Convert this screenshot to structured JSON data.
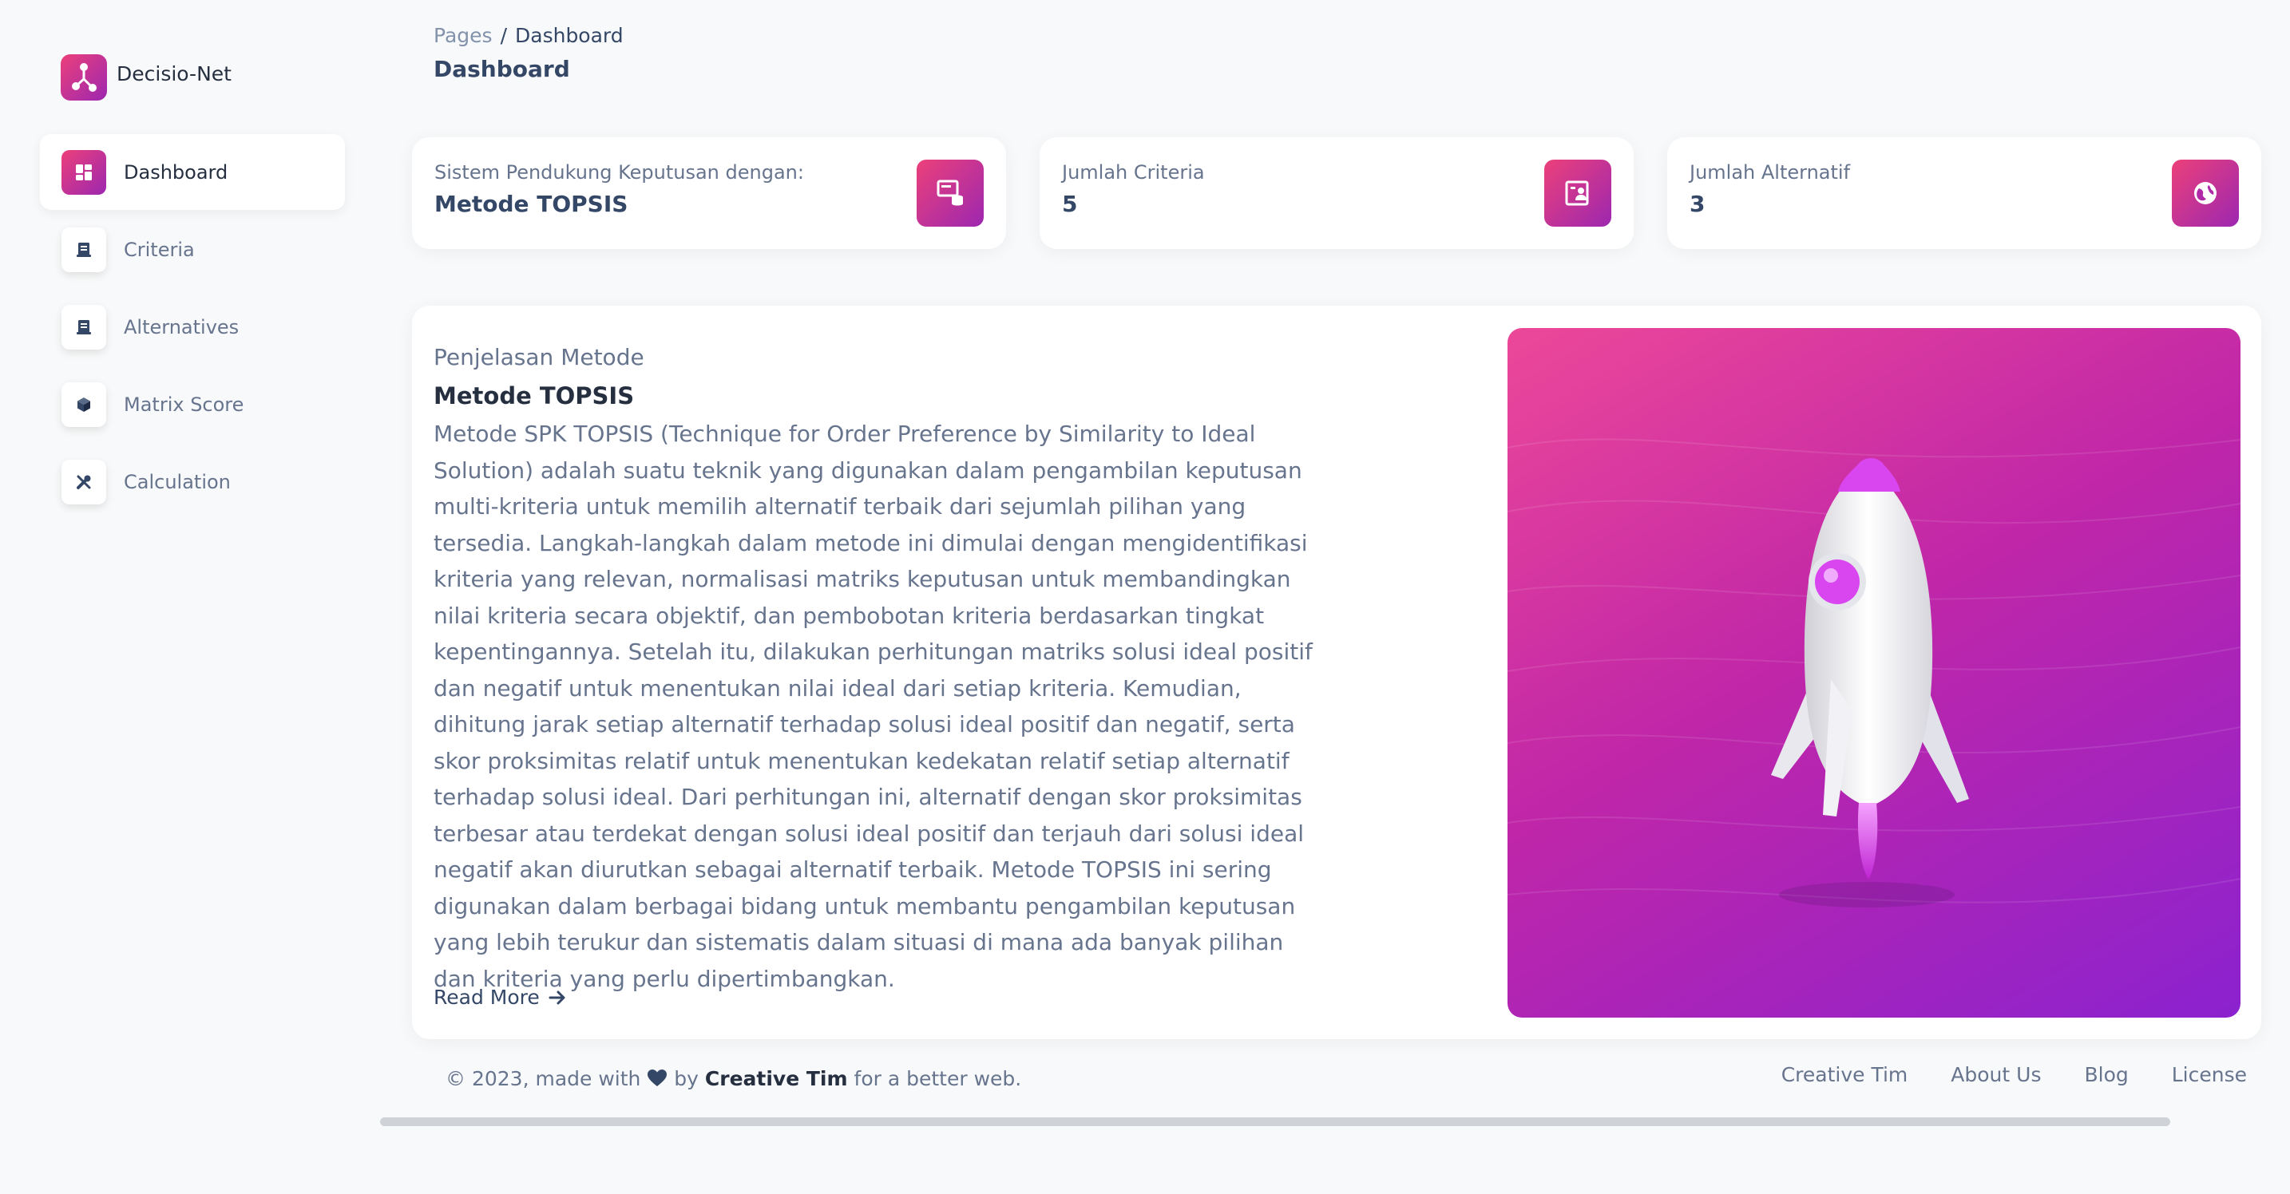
{
  "brand": {
    "name": "Decisio-Net"
  },
  "sidebar": {
    "items": [
      {
        "label": "Dashboard",
        "icon": "dashboard-icon",
        "active": true
      },
      {
        "label": "Criteria",
        "icon": "document-icon"
      },
      {
        "label": "Alternatives",
        "icon": "document-icon"
      },
      {
        "label": "Matrix Score",
        "icon": "cube-icon"
      },
      {
        "label": "Calculation",
        "icon": "tools-icon"
      }
    ]
  },
  "header": {
    "breadcrumb_root": "Pages",
    "breadcrumb_sep": "/",
    "breadcrumb_current": "Dashboard",
    "title": "Dashboard"
  },
  "stats": [
    {
      "label": "Sistem Pendukung Keputusan dengan:",
      "value": "Metode TOPSIS",
      "icon": "database-icon"
    },
    {
      "label": "Jumlah Criteria",
      "value": "5",
      "icon": "user-card-icon"
    },
    {
      "label": "Jumlah Alternatif",
      "value": "3",
      "icon": "globe-icon"
    }
  ],
  "main": {
    "subheading": "Penjelasan Metode",
    "method_title": "Metode TOPSIS",
    "description": "Metode SPK TOPSIS (Technique for Order Preference by Similarity to Ideal Solution) adalah suatu teknik yang digunakan dalam pengambilan keputusan multi-kriteria untuk memilih alternatif terbaik dari sejumlah pilihan yang tersedia. Langkah-langkah dalam metode ini dimulai dengan mengidentifikasi kriteria yang relevan, normalisasi matriks keputusan untuk membandingkan nilai kriteria secara objektif, dan pembobotan kriteria berdasarkan tingkat kepentingannya. Setelah itu, dilakukan perhitungan matriks solusi ideal positif dan negatif untuk menentukan nilai ideal dari setiap kriteria. Kemudian, dihitung jarak setiap alternatif terhadap solusi ideal positif dan negatif, serta skor proksimitas relatif untuk menentukan kedekatan relatif setiap alternatif terhadap solusi ideal. Dari perhitungan ini, alternatif dengan skor proksimitas terbesar atau terdekat dengan solusi ideal positif dan terjauh dari solusi ideal negatif akan diurutkan sebagai alternatif terbaik. Metode TOPSIS ini sering digunakan dalam berbagai bidang untuk membantu pengambilan keputusan yang lebih terukur dan sistematis dalam situasi di mana ada banyak pilihan dan kriteria yang perlu dipertimbangkan.",
    "read_more": "Read More"
  },
  "footer": {
    "copy_prefix": "© 2023, made with",
    "copy_by": "by",
    "copy_author": "Creative Tim",
    "copy_suffix": "for a better web.",
    "links": [
      "Creative Tim",
      "About Us",
      "Blog",
      "License"
    ]
  },
  "colors": {
    "accent_start": "#ec407a",
    "accent_end": "#9c27b0",
    "text_primary": "#344767",
    "text_muted": "#67748e"
  }
}
